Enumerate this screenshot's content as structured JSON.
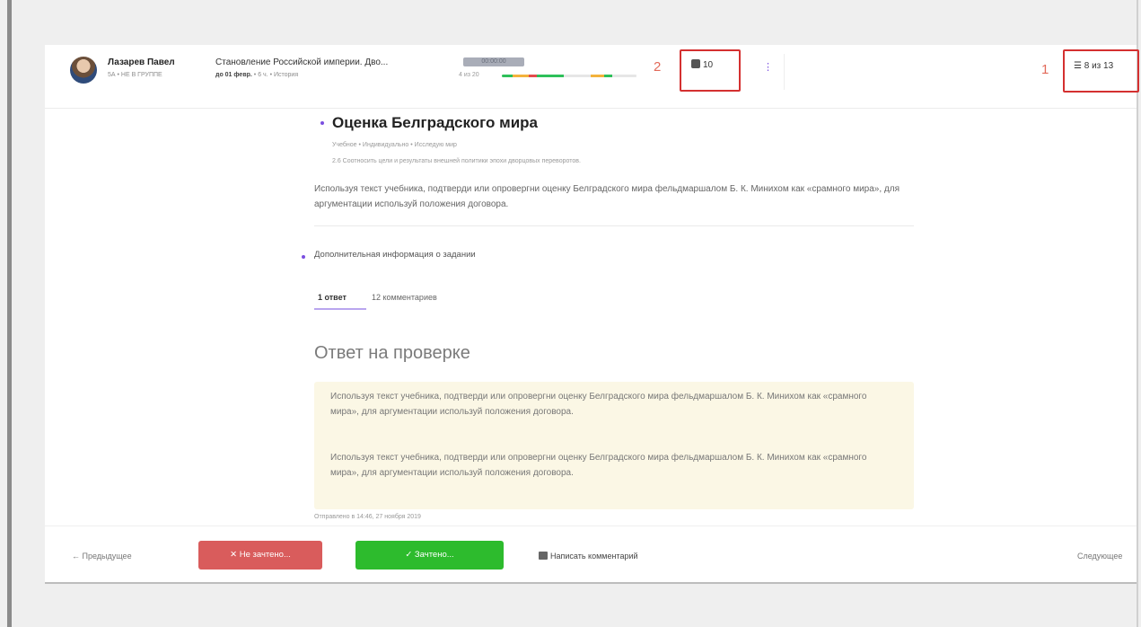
{
  "header": {
    "student_name": "Лазарев Павел",
    "student_meta": "5А • НЕ В ГРУППЕ",
    "task_title": "Становление Российской империи. Дво...",
    "task_deadline": "до 01 февр.",
    "task_meta_rest": " • 6 ч. • История",
    "progress_badge": "00:00:00",
    "progress_label": "4 из 20",
    "progress_segments": [
      {
        "color": "#2ec05a",
        "fraction": 0.08
      },
      {
        "color": "#f3b23c",
        "fraction": 0.12
      },
      {
        "color": "#e44c4c",
        "fraction": 0.06
      },
      {
        "color": "#2ec05a",
        "fraction": 0.2
      },
      {
        "color": "#e6e6e6",
        "fraction": 0.2
      },
      {
        "color": "#f3b23c",
        "fraction": 0.1
      },
      {
        "color": "#2ec05a",
        "fraction": 0.06
      },
      {
        "color": "#e6e6e6",
        "fraction": 0.18
      }
    ],
    "annotation_2": "2",
    "tasks_count": "10",
    "more_label": "⋮",
    "annotation_1": "1",
    "pager": "8 из 13"
  },
  "question": {
    "title": "Оценка Белградского мира",
    "meta": "Учебное • Индивидуально • Исследую мир",
    "skill": "2.6 Соотносить цели и результаты внешней политики эпохи дворцовых переворотов.",
    "text": "Используя текст учебника, подтверди или опровергни оценку Белградского мира фельдмаршалом Б. К. Минихом как «срамного мира», для аргументации используй положения договора.",
    "extra_info": "Дополнительная информация о задании"
  },
  "tabs": {
    "answers": "1 ответ",
    "comments": "12 комментариев"
  },
  "answer": {
    "status_title": "Ответ на проверке",
    "paragraph_1": "Используя текст учебника, подтверди или опровергни оценку Белградского мира фельдмаршалом Б. К. Минихом как «срамного мира», для аргументации используй положения договора.",
    "paragraph_2": "Используя текст учебника, подтверди или опровергни оценку Белградского мира фельдмаршалом Б. К. Минихом как «срамного мира», для аргументации используй положения договора.",
    "sent_at": "Отправлено в 14:46, 27 ноября 2019"
  },
  "footer": {
    "prev": "← Предыдущее",
    "reject": "✕ Не зачтено...",
    "accept": "✓ Зачтено...",
    "comment": "Написать комментарий",
    "next": "Следующее"
  },
  "colors": {
    "accent": "#7b4fe0",
    "reject": "#d95c5c",
    "accept": "#2dbb2d",
    "annotation_box": "#d43030",
    "answer_bg": "#fbf7e5"
  }
}
